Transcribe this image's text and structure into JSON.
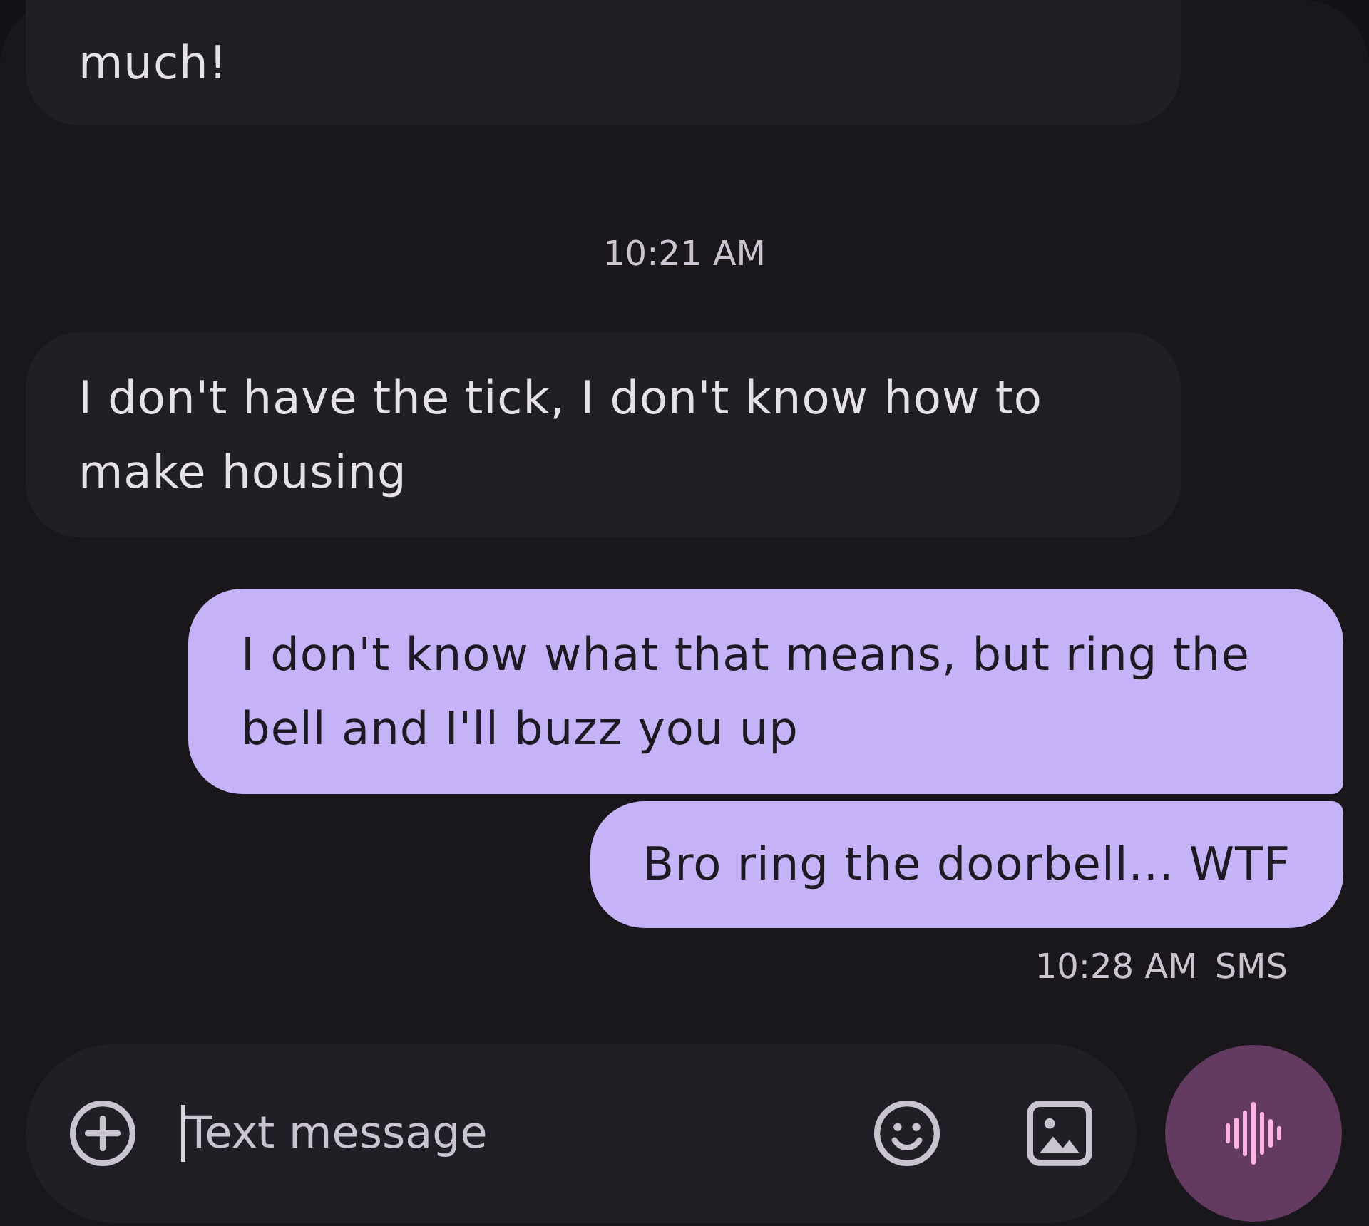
{
  "messages": [
    {
      "kind": "received",
      "text": "much!",
      "cut_off": true
    },
    {
      "kind": "timestamp",
      "text": "10:21 AM"
    },
    {
      "kind": "received",
      "text": "I don't have the tick, I don't know how to make housing",
      "cut_off": false
    },
    {
      "kind": "sent",
      "text": "I don't know what that means, but ring the bell and I'll buzz you up",
      "cut_off": false
    },
    {
      "kind": "sent",
      "text": "Bro ring the doorbell... WTF",
      "cut_off": false
    },
    {
      "kind": "status",
      "time": "10:28 AM",
      "channel": "SMS"
    }
  ],
  "composer": {
    "placeholder": "Text message"
  }
}
